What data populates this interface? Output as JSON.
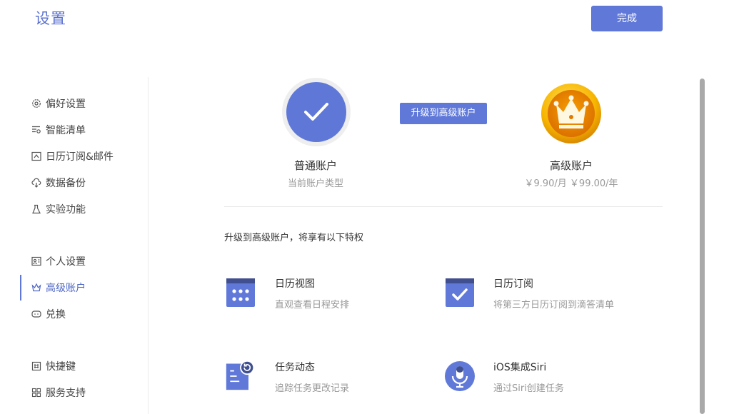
{
  "header": {
    "title": "设置",
    "done_label": "完成"
  },
  "sidebar": {
    "items": [
      {
        "label": "偏好设置",
        "icon": "gear-icon"
      },
      {
        "label": "智能清单",
        "icon": "smart-list-icon"
      },
      {
        "label": "日历订阅&邮件",
        "icon": "calendar-mail-icon"
      },
      {
        "label": "数据备份",
        "icon": "cloud-backup-icon"
      },
      {
        "label": "实验功能",
        "icon": "flask-icon"
      },
      {
        "label": "个人设置",
        "icon": "profile-card-icon"
      },
      {
        "label": "高级账户",
        "icon": "crown-icon",
        "active": true
      },
      {
        "label": "兑换",
        "icon": "ticket-icon"
      },
      {
        "label": "快捷键",
        "icon": "keyboard-icon"
      },
      {
        "label": "服务支持",
        "icon": "grid-icon"
      }
    ]
  },
  "account": {
    "basic_name": "普通账户",
    "basic_sub": "当前账户类型",
    "upgrade_label": "升级到高级账户",
    "premium_name": "高级账户",
    "premium_price": "￥9.90/月 ￥99.00/年"
  },
  "features": {
    "heading": "升级到高级账户，将享有以下特权",
    "items": [
      {
        "title": "日历视图",
        "desc": "直观查看日程安排",
        "icon": "calendar-grid-icon"
      },
      {
        "title": "日历订阅",
        "desc": "将第三方日历订阅到滴答清单",
        "icon": "calendar-check-icon"
      },
      {
        "title": "任务动态",
        "desc": "追踪任务更改记录",
        "icon": "task-history-icon"
      },
      {
        "title": "iOS集成Siri",
        "desc": "通过Siri创建任务",
        "icon": "microphone-icon"
      }
    ]
  },
  "colors": {
    "accent": "#6079d9",
    "gold": "#f5a300"
  }
}
